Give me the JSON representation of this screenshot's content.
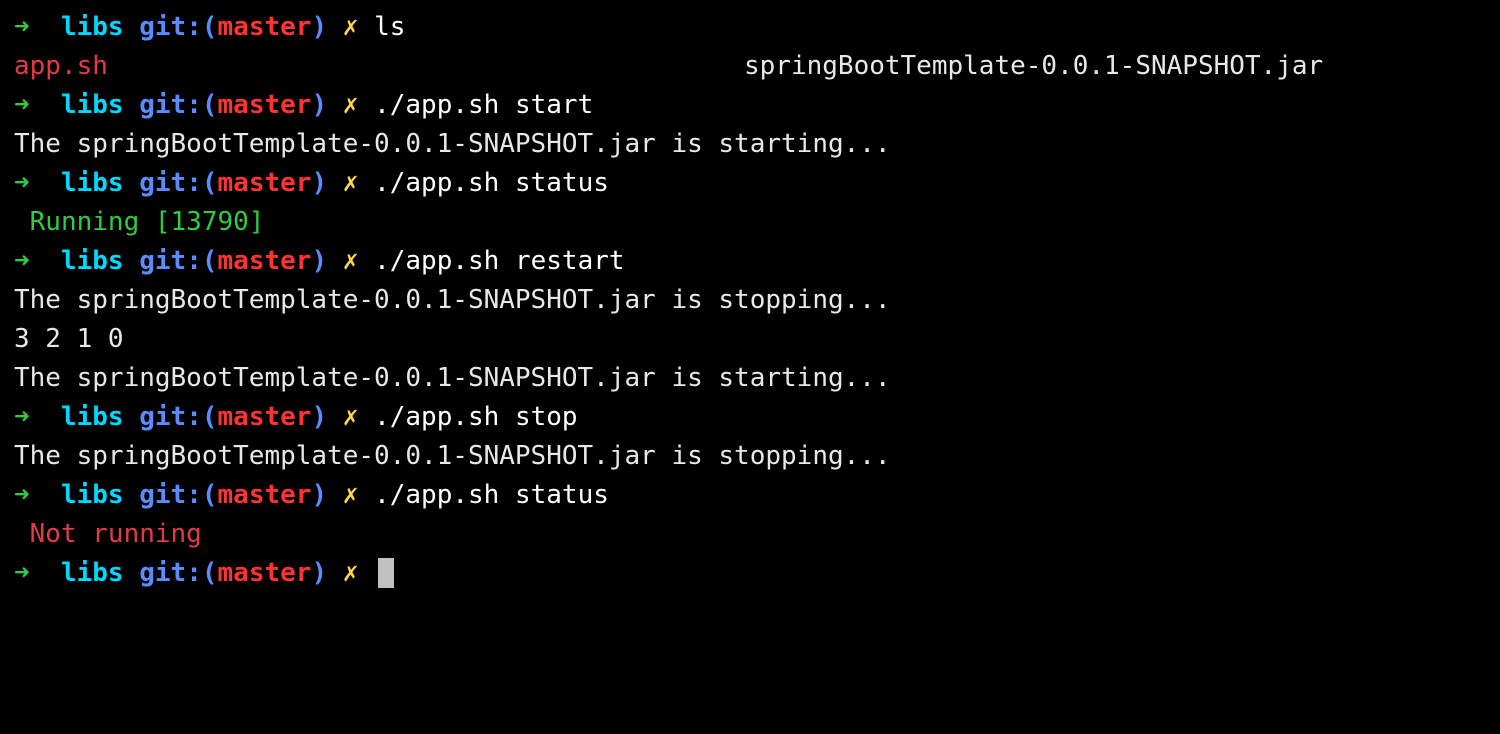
{
  "prompt": {
    "arrow": "➜",
    "dir": "libs",
    "git_label": "git:(",
    "git_branch": "master",
    "git_close": ")",
    "dirty": "✗"
  },
  "lines": [
    {
      "type": "prompt",
      "cmd": "ls"
    },
    {
      "type": "ls",
      "col1": "app.sh",
      "col2": "springBootTemplate-0.0.1-SNAPSHOT.jar"
    },
    {
      "type": "prompt",
      "cmd": "./app.sh start"
    },
    {
      "type": "output",
      "style": "default",
      "text": "The springBootTemplate-0.0.1-SNAPSHOT.jar is starting..."
    },
    {
      "type": "prompt",
      "cmd": "./app.sh status"
    },
    {
      "type": "output",
      "style": "green",
      "text": " Running [13790]"
    },
    {
      "type": "prompt",
      "cmd": "./app.sh restart"
    },
    {
      "type": "output",
      "style": "default",
      "text": "The springBootTemplate-0.0.1-SNAPSHOT.jar is stopping..."
    },
    {
      "type": "output",
      "style": "default",
      "text": "3 2 1 0"
    },
    {
      "type": "output",
      "style": "default",
      "text": "The springBootTemplate-0.0.1-SNAPSHOT.jar is starting..."
    },
    {
      "type": "prompt",
      "cmd": "./app.sh stop"
    },
    {
      "type": "output",
      "style": "default",
      "text": "The springBootTemplate-0.0.1-SNAPSHOT.jar is stopping..."
    },
    {
      "type": "prompt",
      "cmd": "./app.sh status"
    },
    {
      "type": "output",
      "style": "red",
      "text": " Not running"
    },
    {
      "type": "prompt-cursor"
    }
  ]
}
